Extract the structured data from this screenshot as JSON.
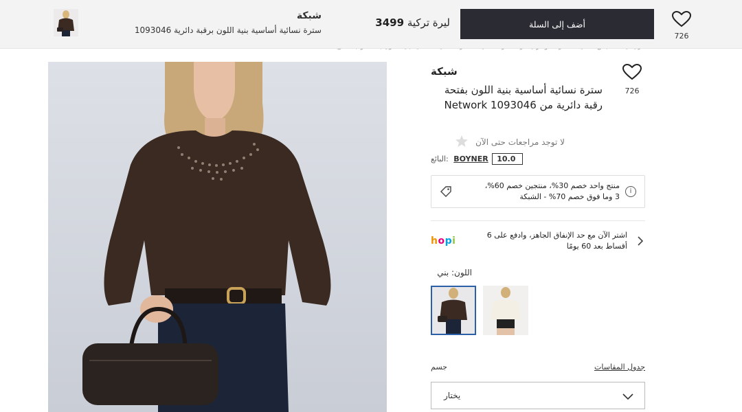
{
  "sticky_bar": {
    "favorites_count": "726",
    "add_to_cart_label": "أضف إلى السلة",
    "price_value": "3499",
    "price_currency": "ليرة تركية",
    "brand": "شبكة",
    "product_name": "سترة نسائية أساسية بنية اللون برقبة دائرية 1093046"
  },
  "breadcrumb": "الرئيسية / ملابس نسائية / سترات وكارديغانز / سترة نسائية / سترة نسائية أساسية بنية اللون بفتحة رقبة دائرية",
  "product": {
    "brand": "شبكة",
    "favorites_count": "726",
    "title": "سترة نسائية أساسية بنية اللون بفتحة رقبة دائرية من Network 1093046",
    "no_reviews": "لا توجد مراجعات حتى الآن",
    "seller_label": "البائع:",
    "seller_name": "BOYNER",
    "seller_score": "10.0"
  },
  "promo": {
    "text_line1": "منتج واحد خصم 30%، منتجين خصم 60%،",
    "text_line2": "3 وما فوق خصم 70% - الشبكة"
  },
  "installment": {
    "logo": "hopi",
    "text_line1": "اشتر الآن مع حد الإنفاق الجاهز، وادفع على 6",
    "text_line2": "أقساط بعد 60 يومًا"
  },
  "color": {
    "label": "اللون: بني",
    "options": [
      "بني",
      "أبيض"
    ]
  },
  "size": {
    "label": "جسم",
    "chart_link": "جدول المقاسات",
    "select_placeholder": "يختار"
  },
  "colors": {
    "cart_button": "#2b2b34",
    "selected_swatch_border": "#2b5fa8",
    "sweater": "#3a2a22"
  },
  "icons": [
    "heart-icon",
    "price-tag-icon",
    "info-icon",
    "chevron-right-icon",
    "chevron-down-icon",
    "star-icon"
  ]
}
